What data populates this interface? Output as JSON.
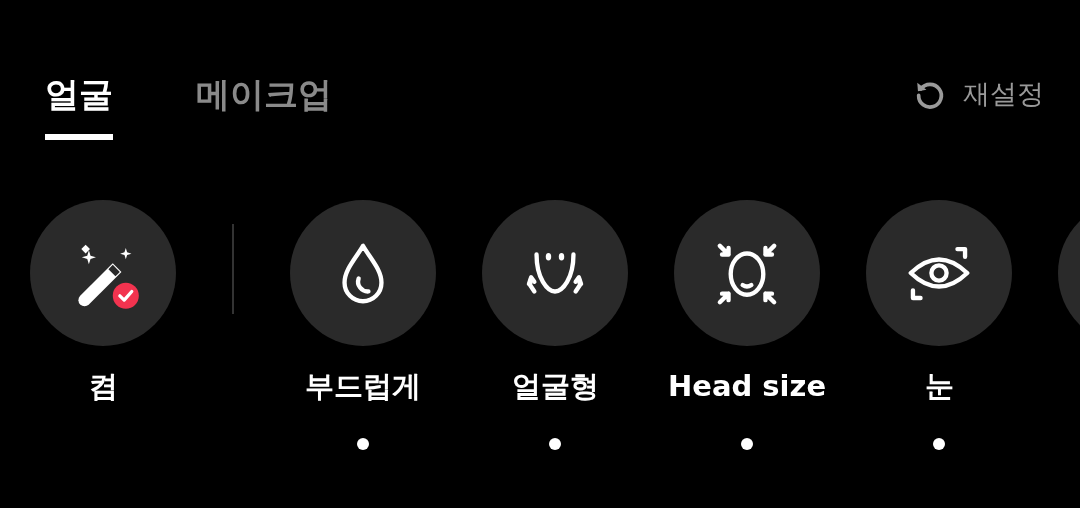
{
  "tabs": [
    {
      "label": "얼굴",
      "selected": true
    },
    {
      "label": "메이크업",
      "selected": false
    }
  ],
  "reset_button": {
    "label": "재설정"
  },
  "items": [
    {
      "kind": "wand",
      "label": "켬",
      "modified": false
    },
    {
      "kind": "drop",
      "label": "부드럽게",
      "modified": true
    },
    {
      "kind": "face_shape",
      "label": "얼굴형",
      "modified": true
    },
    {
      "kind": "head_size",
      "label": "Head size",
      "modified": true
    },
    {
      "kind": "eye",
      "label": "눈",
      "modified": true
    },
    {
      "kind": "partial"
    }
  ]
}
